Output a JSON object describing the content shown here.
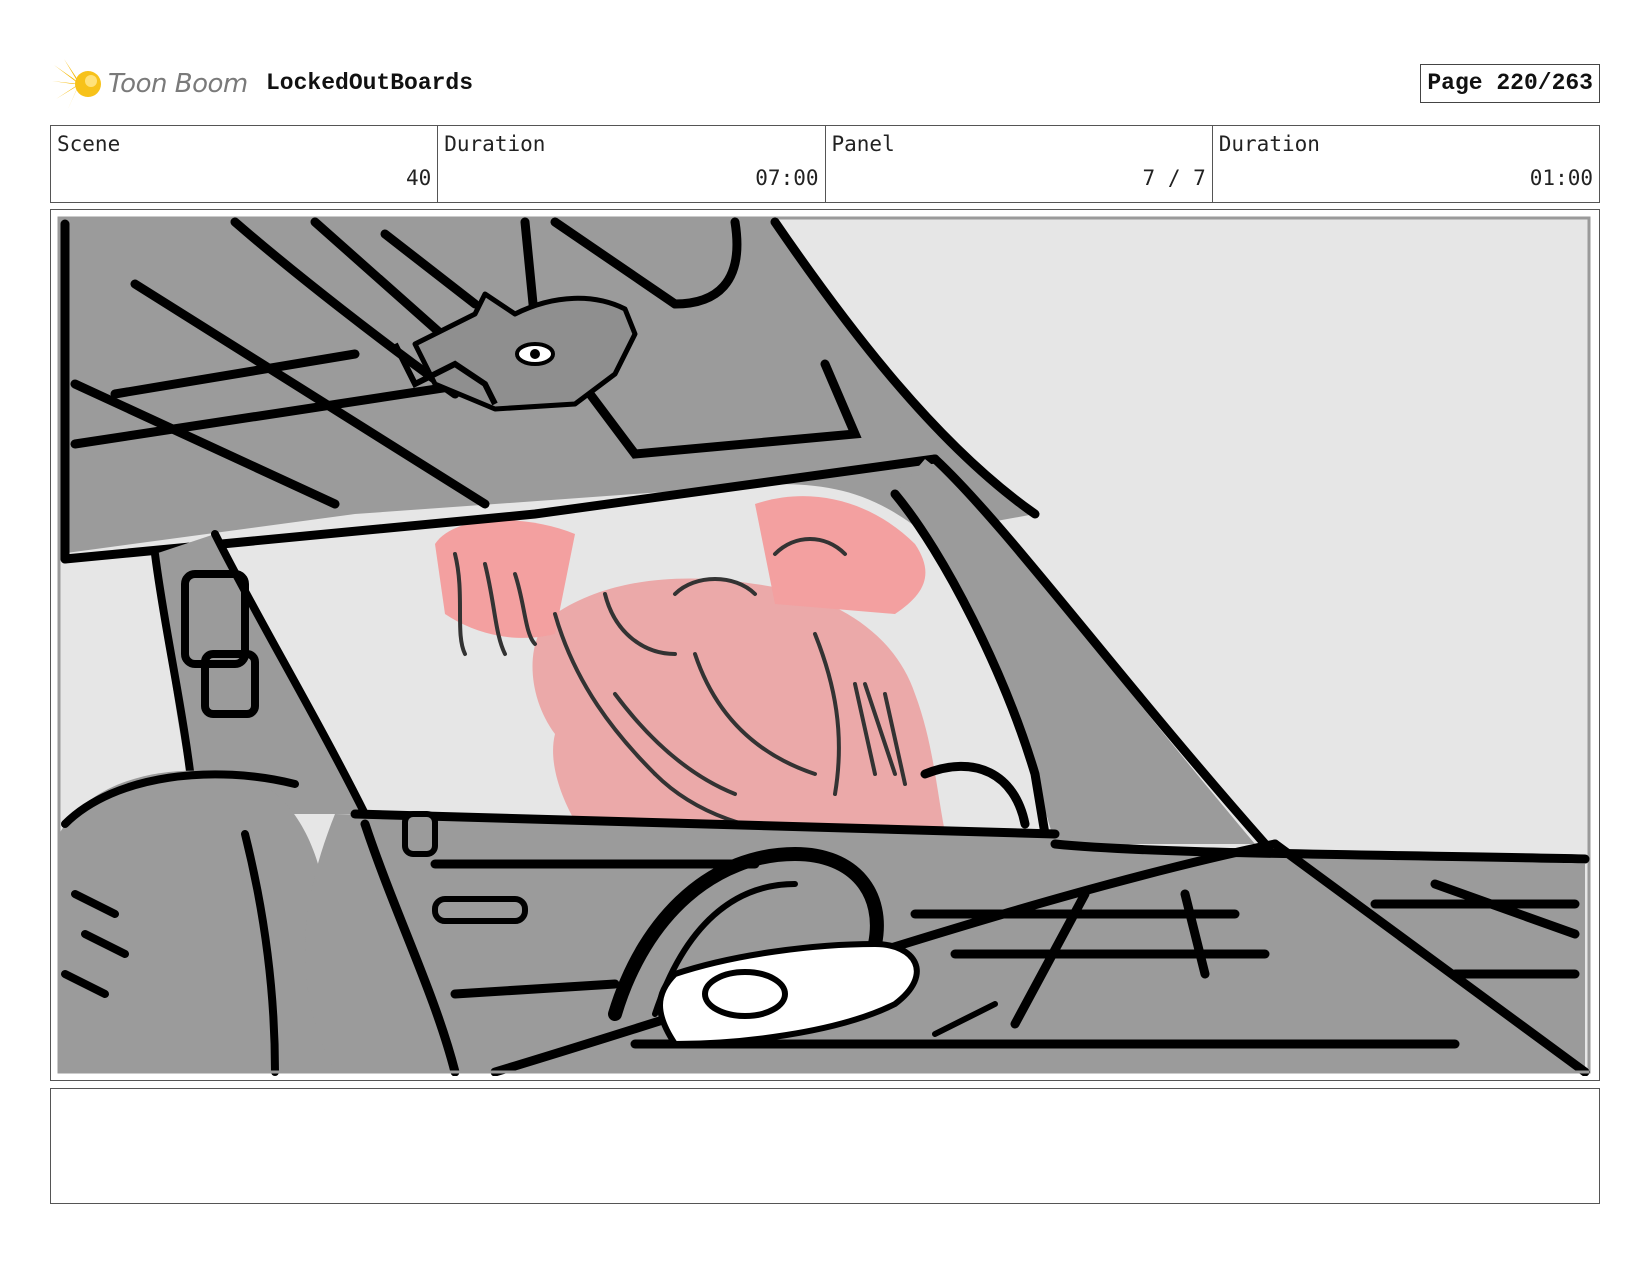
{
  "header": {
    "logo_text": "Toon Boom",
    "project_title": "LockedOutBoards",
    "page_label": "Page 220/263"
  },
  "info": {
    "scene_label": "Scene",
    "scene_value": "40",
    "scene_duration_label": "Duration",
    "scene_duration_value": "07:00",
    "panel_label": "Panel",
    "panel_value": "7 / 7",
    "panel_duration_label": "Duration",
    "panel_duration_value": "01:00"
  },
  "notes": {
    "text": ""
  },
  "colors": {
    "logo_accent": "#f5b800",
    "logo_text": "#7a7a7a",
    "car_interior": "#9b9b9b",
    "background": "#e6e6e6",
    "character": "#f0a8a8",
    "linework": "#000000"
  }
}
